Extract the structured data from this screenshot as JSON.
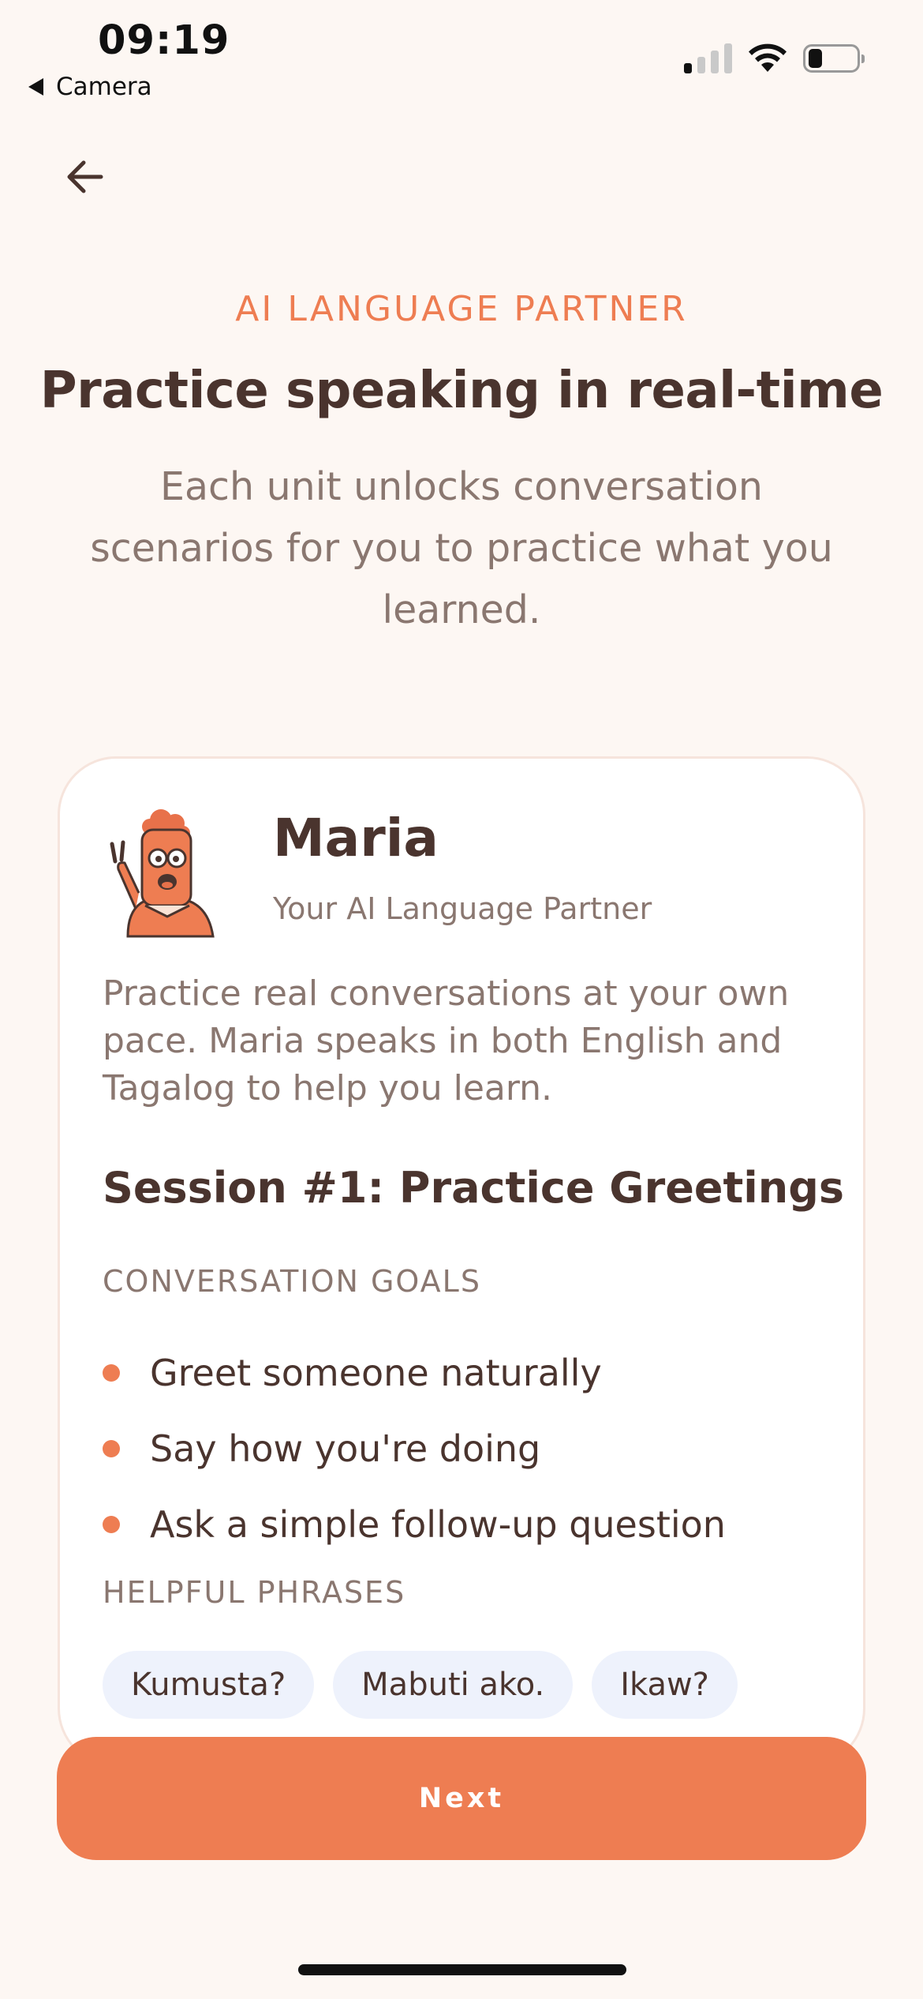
{
  "status_bar": {
    "time": "09:19",
    "back_app": "Camera",
    "signal_bars_active": 1,
    "battery_level": 0.25
  },
  "header": {
    "eyebrow": "AI LANGUAGE PARTNER",
    "title": "Practice speaking in real-time",
    "subtitle": "Each unit unlocks conversation scenarios for you to practice what you learned."
  },
  "partner_card": {
    "name": "Maria",
    "role": "Your AI Language Partner",
    "description": "Practice real conversations at your own pace. Maria speaks in both English and Tagalog to help you learn.",
    "session_title": "Session #1: Practice Greetings",
    "goals_label": "CONVERSATION GOALS",
    "goals": [
      "Greet someone naturally",
      "Say how you're doing",
      "Ask a simple follow-up question"
    ],
    "phrases_label": "HELPFUL PHRASES",
    "phrases": [
      "Kumusta?",
      "Mabuti ako.",
      "Ikaw?"
    ]
  },
  "next_button": {
    "label": "Next"
  },
  "colors": {
    "accent": "#EE7D52",
    "background": "#FDF7F3",
    "heading": "#4A342E",
    "muted": "#8A7770",
    "chip": "#EEF2FC"
  },
  "icons": {
    "back": "arrow-left-icon",
    "avatar": "maria-avatar-illustration"
  }
}
